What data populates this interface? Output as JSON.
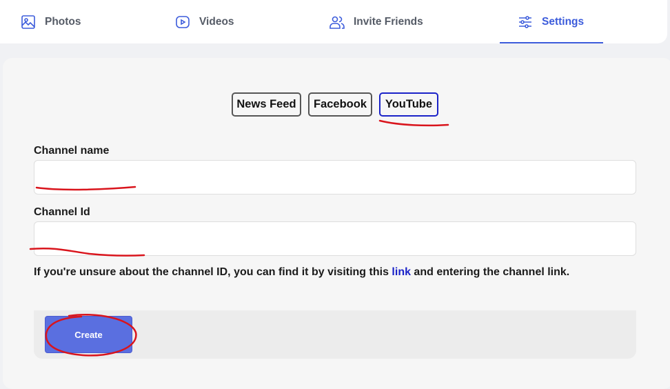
{
  "nav": {
    "tabs": [
      {
        "label": "Photos",
        "icon": "photo-icon"
      },
      {
        "label": "Videos",
        "icon": "video-icon"
      },
      {
        "label": "Invite Friends",
        "icon": "users-icon"
      },
      {
        "label": "Settings",
        "icon": "sliders-icon",
        "active": true
      }
    ]
  },
  "feed_tabs": [
    {
      "label": "News Feed"
    },
    {
      "label": "Facebook"
    },
    {
      "label": "YouTube",
      "active": true
    }
  ],
  "form": {
    "channel_name": {
      "label": "Channel name",
      "value": ""
    },
    "channel_id": {
      "label": "Channel Id",
      "value": ""
    },
    "help_before": "If you're unsure about the channel ID, you can find it by visiting this ",
    "help_link": "link",
    "help_after": " and entering the channel link."
  },
  "create_button": {
    "label": "Create"
  },
  "colors": {
    "accent": "#3b5bdb",
    "button": "#5a6fe0",
    "active_border": "#1a22c8",
    "annotation": "#d9141c"
  }
}
